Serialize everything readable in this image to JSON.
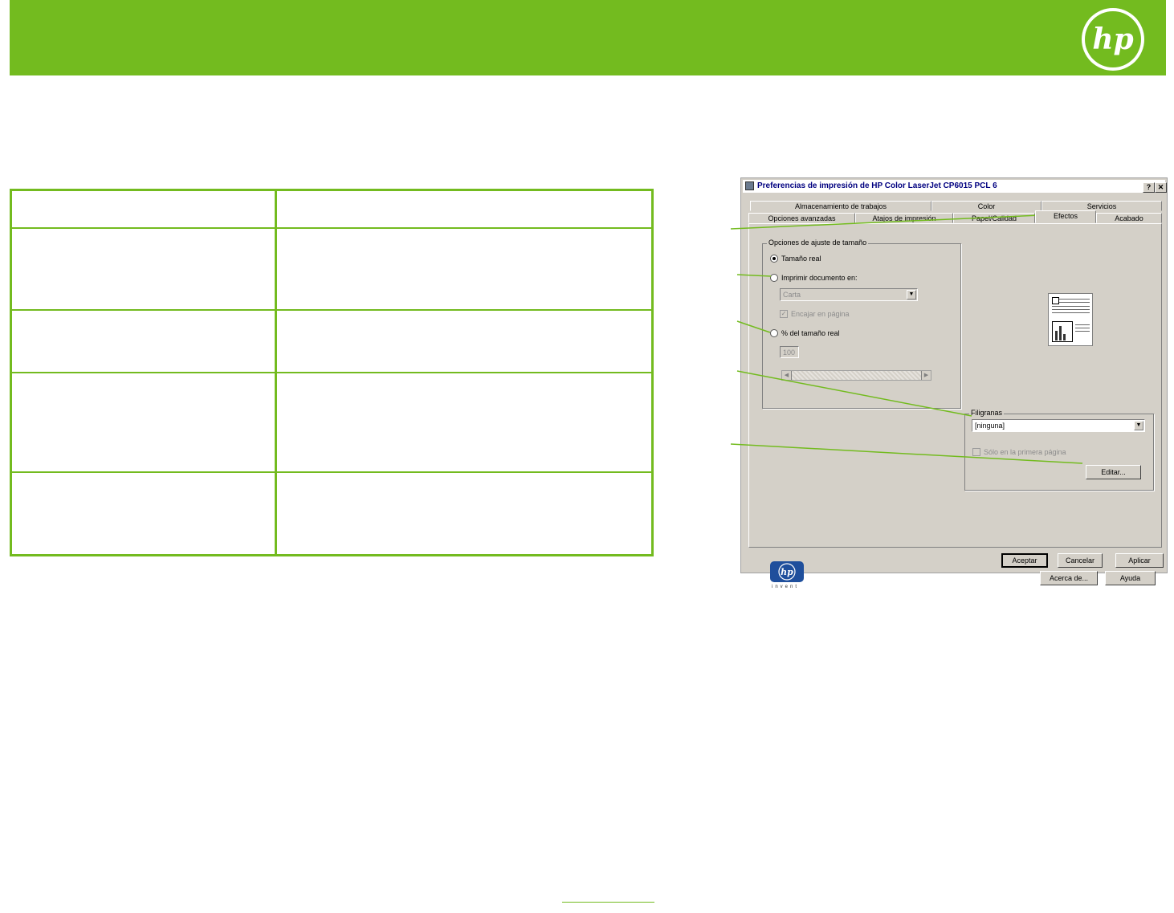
{
  "brand": {
    "accent_color": "#73bb1f",
    "logo_text": "hp"
  },
  "dialog": {
    "title": "Preferencias de impresión de HP Color LaserJet CP6015 PCL 6",
    "title_buttons": {
      "help": "?",
      "close": "✕"
    },
    "tabs_row1": [
      "Almacenamiento de trabajos",
      "Color",
      "Servicios"
    ],
    "tabs_row2": [
      "Opciones avanzadas",
      "Atajos de impresión",
      "Papel/Calidad",
      "Efectos",
      "Acabado"
    ],
    "active_tab": "Efectos",
    "resize_group": {
      "label": "Opciones de ajuste de tamaño",
      "option_actual": "Tamaño real",
      "option_print_on": "Imprimir documento en:",
      "paper_select": "Carta",
      "fit_to_page": "Encajar en página",
      "option_percent": "% del tamaño real",
      "percent_value": "100",
      "selected_option": "Tamaño real"
    },
    "watermark_group": {
      "label": "Filigranas",
      "select_value": "[ninguna]",
      "first_page_only": "Sólo en la primera página",
      "edit_button": "Editar..."
    },
    "logo_caption": "invent",
    "buttons": {
      "about": "Acerca de...",
      "help": "Ayuda",
      "ok": "Aceptar",
      "cancel": "Cancelar",
      "apply": "Aplicar"
    }
  }
}
